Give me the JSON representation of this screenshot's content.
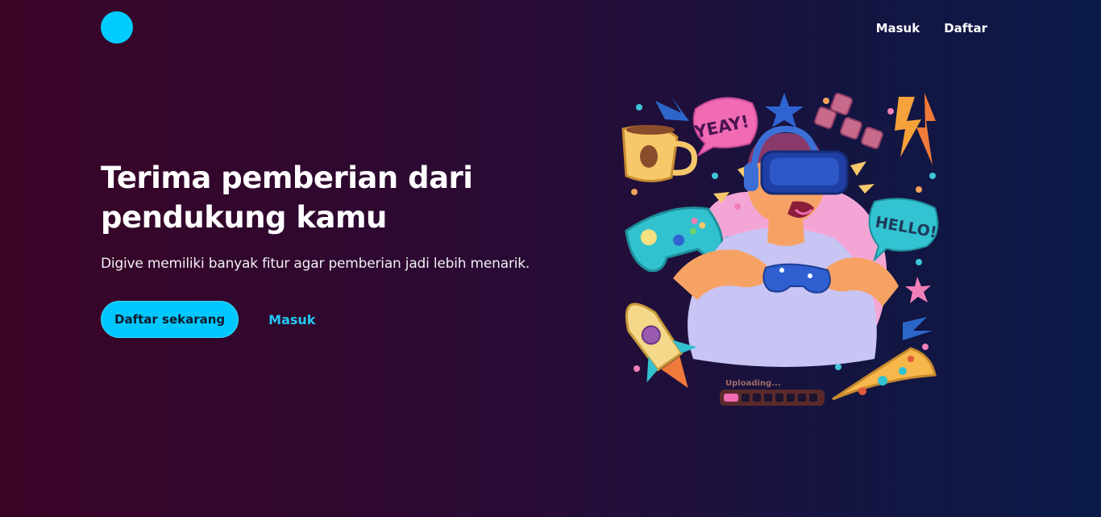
{
  "header": {
    "nav": [
      {
        "label": "Masuk"
      },
      {
        "label": "Daftar"
      }
    ]
  },
  "hero": {
    "title_line1": "Terima pemberian dari",
    "title_line2": "pendukung kamu",
    "subtitle": "Digive memiliki banyak fitur agar pemberian jadi lebih menarik.",
    "primary_button": "Daftar sekarang",
    "secondary_link": "Masuk"
  },
  "illustration": {
    "bubble_yeay": "YEAY!",
    "bubble_hello": "HELLO!",
    "upload_label": "Uploading..."
  },
  "colors": {
    "accent": "#00c8ff",
    "link": "#21c9f3",
    "background_left": "#3a0426",
    "background_right": "#0b1a48"
  }
}
